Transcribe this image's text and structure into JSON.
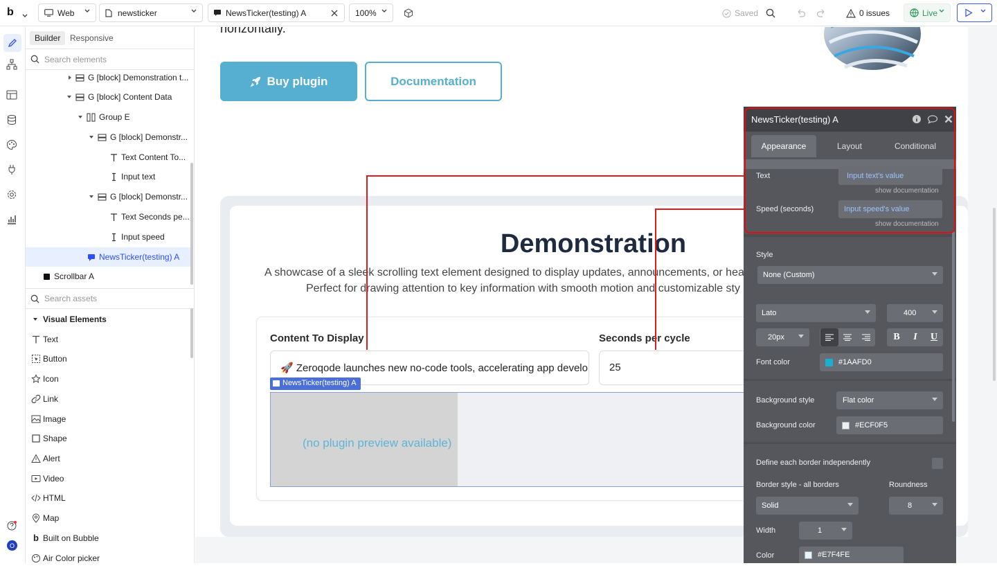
{
  "topbar": {
    "platform": "Web",
    "page_name": "newsticker",
    "element_tab": "NewsTicker(testing) A",
    "zoom": "100%",
    "saved": "Saved",
    "issues": "0 issues",
    "live": "Live"
  },
  "panel": {
    "tab_builder": "Builder",
    "tab_responsive": "Responsive",
    "search_elements_placeholder": "Search elements",
    "tree": [
      "G [block] Demonstration t...",
      "G [block] Content Data",
      "Group E",
      "G [block] Demonstr...",
      "Text Content To...",
      "Input text",
      "G [block] Demonstr...",
      "Text Seconds pe...",
      "Input speed",
      "NewsTicker(testing) A",
      "Scrollbar A"
    ],
    "search_assets_placeholder": "Search assets",
    "visual_elements_header": "Visual Elements",
    "visual_elements": [
      "Text",
      "Button",
      "Icon",
      "Link",
      "Image",
      "Shape",
      "Alert",
      "Video",
      "HTML",
      "Map",
      "Built on Bubble",
      "Air Color picker"
    ],
    "user_initial": "O"
  },
  "canvas": {
    "hero_text": "horizontally.",
    "buy_button": "Buy plugin",
    "doc_button": "Documentation",
    "demo_title": "Demonstration",
    "demo_desc_line1": "A showcase of a sleek scrolling text element designed to display updates, announcements, or headl",
    "demo_desc_line2": "Perfect for drawing attention to key information with smooth motion and customizable sty",
    "label_content": "Content To Display",
    "label_seconds": "Seconds per cycle",
    "content_value": "🚀 Zeroqode launches new no-code tools, accelerating app developme",
    "seconds_value": "25",
    "element_tag": "NewsTicker(testing) A",
    "no_preview": "(no plugin preview available)"
  },
  "properties": {
    "title": "NewsTicker(testing) A",
    "tabs": [
      "Appearance",
      "Layout",
      "Conditional"
    ],
    "text_label": "Text",
    "text_value": "Input text's value",
    "show_doc_1": "show documentation",
    "speed_label": "Speed (seconds)",
    "speed_value": "Input speed's value",
    "show_doc_2": "show documentation",
    "style_label": "Style",
    "style_value": "None (Custom)",
    "font": "Lato",
    "font_weight": "400",
    "font_size": "20px",
    "font_color_label": "Font color",
    "font_color": "#1AAFD0",
    "bg_style_label": "Background style",
    "bg_style": "Flat color",
    "bg_color_label": "Background color",
    "bg_color": "#ECF0F5",
    "border_indep_label": "Define each border independently",
    "border_style_label": "Border style - all borders",
    "roundness_label": "Roundness",
    "border_style": "Solid",
    "roundness": "8",
    "width_label": "Width",
    "width_value": "1",
    "color_label": "Color",
    "color_value": "#E7F4FE"
  }
}
